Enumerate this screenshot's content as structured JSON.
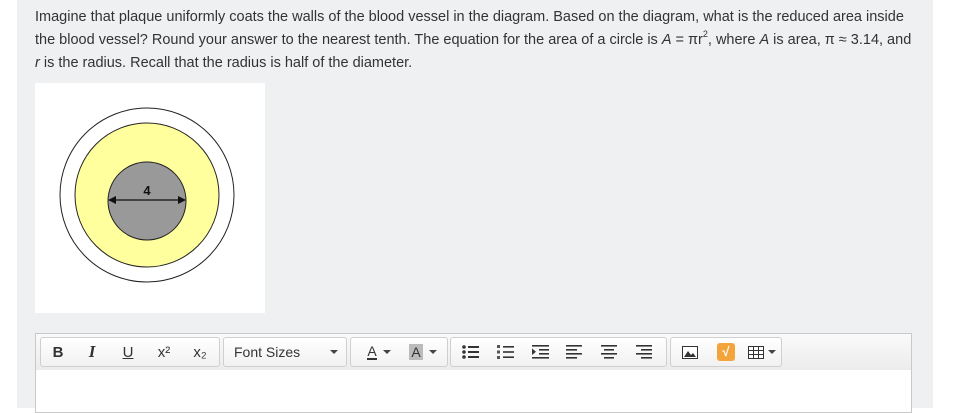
{
  "question": {
    "part1": "Imagine that plaque uniformly coats the walls of the blood vessel in the diagram. Based on the diagram, what is the reduced area inside the blood vessel? Round your answer to the nearest tenth. The equation for the area of a circle is ",
    "formula_A": "A",
    "formula_eq": " = πr",
    "formula_exp": "2",
    "part2": ", where ",
    "var_A": "A",
    "part3": " is area, π ≈ 3.14, and ",
    "var_r": "r",
    "part4": " is the radius. Recall that the radius is half of the diameter."
  },
  "diagram": {
    "diameter_label": "4",
    "colors": {
      "plaque": "#ffff9e",
      "lumen": "#999999",
      "outer": "#ffffff",
      "stroke": "#222222"
    }
  },
  "toolbar": {
    "bold": "B",
    "italic": "I",
    "underline": "U",
    "superscript": "x²",
    "subscript": "x₂",
    "font_sizes": "Font Sizes",
    "font_color": "A",
    "bg_color": "A",
    "icons": [
      "bullet-list-icon",
      "numbered-list-icon",
      "indent-icon",
      "align-left-icon",
      "align-center-icon",
      "align-right-icon",
      "image-icon",
      "math-icon",
      "table-icon"
    ]
  }
}
